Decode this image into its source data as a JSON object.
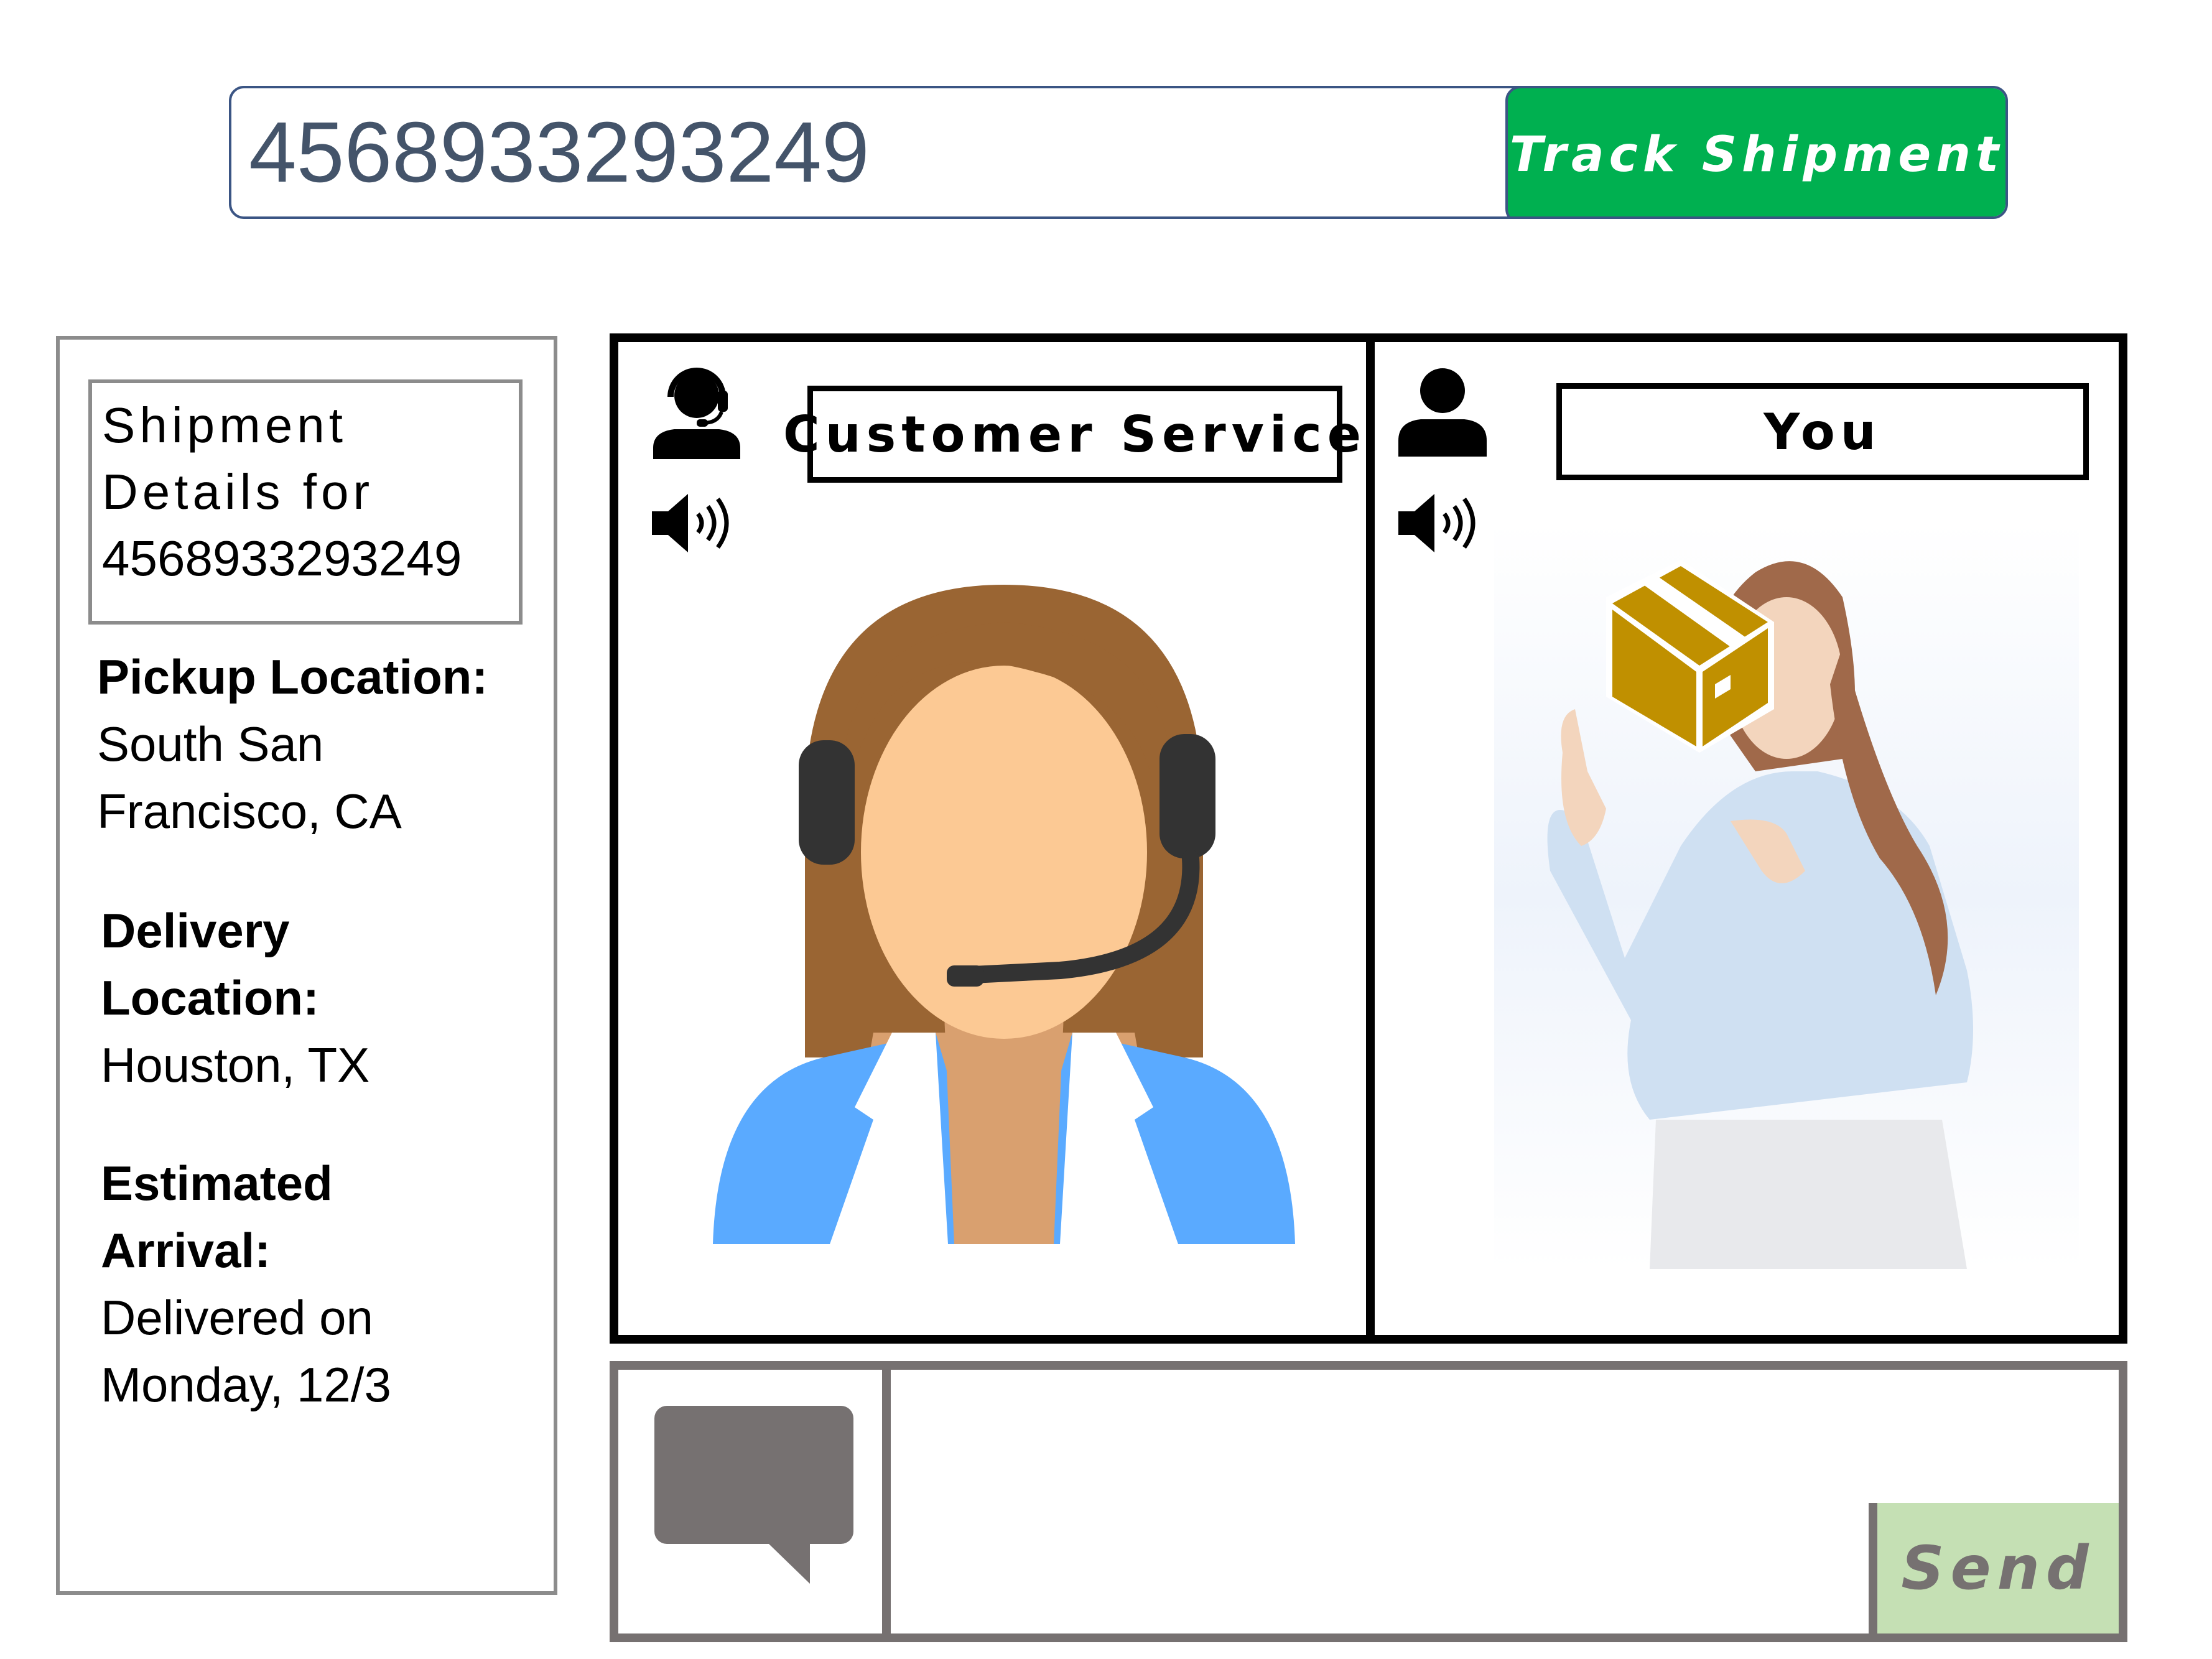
{
  "tracking": {
    "number_value": "4568933293249",
    "button_label": "Track Shipment",
    "button_color": "#00b050",
    "border_color": "#3b5584"
  },
  "details": {
    "title_lines": [
      "Shipment",
      "Details for",
      "4568933293249"
    ],
    "pickup": {
      "label": "Pickup Location:",
      "value_lines": [
        "South San",
        "Francisco, CA"
      ]
    },
    "delivery": {
      "label_lines": [
        "Delivery",
        "Location:"
      ],
      "value": "Houston, TX"
    },
    "arrival": {
      "label_lines": [
        "Estimated",
        "Arrival:"
      ],
      "value_lines": [
        "Delivered on",
        "Monday, 12/3"
      ]
    }
  },
  "video": {
    "agent": {
      "name": "Customer Service",
      "icons": [
        "support-agent-icon",
        "speaker-icon"
      ]
    },
    "user": {
      "name": "You",
      "icons": [
        "person-icon",
        "speaker-icon"
      ]
    }
  },
  "chat": {
    "send_label": "Send",
    "send_color": "#c5e0b4",
    "icons": [
      "chat-bubble-icon"
    ]
  }
}
